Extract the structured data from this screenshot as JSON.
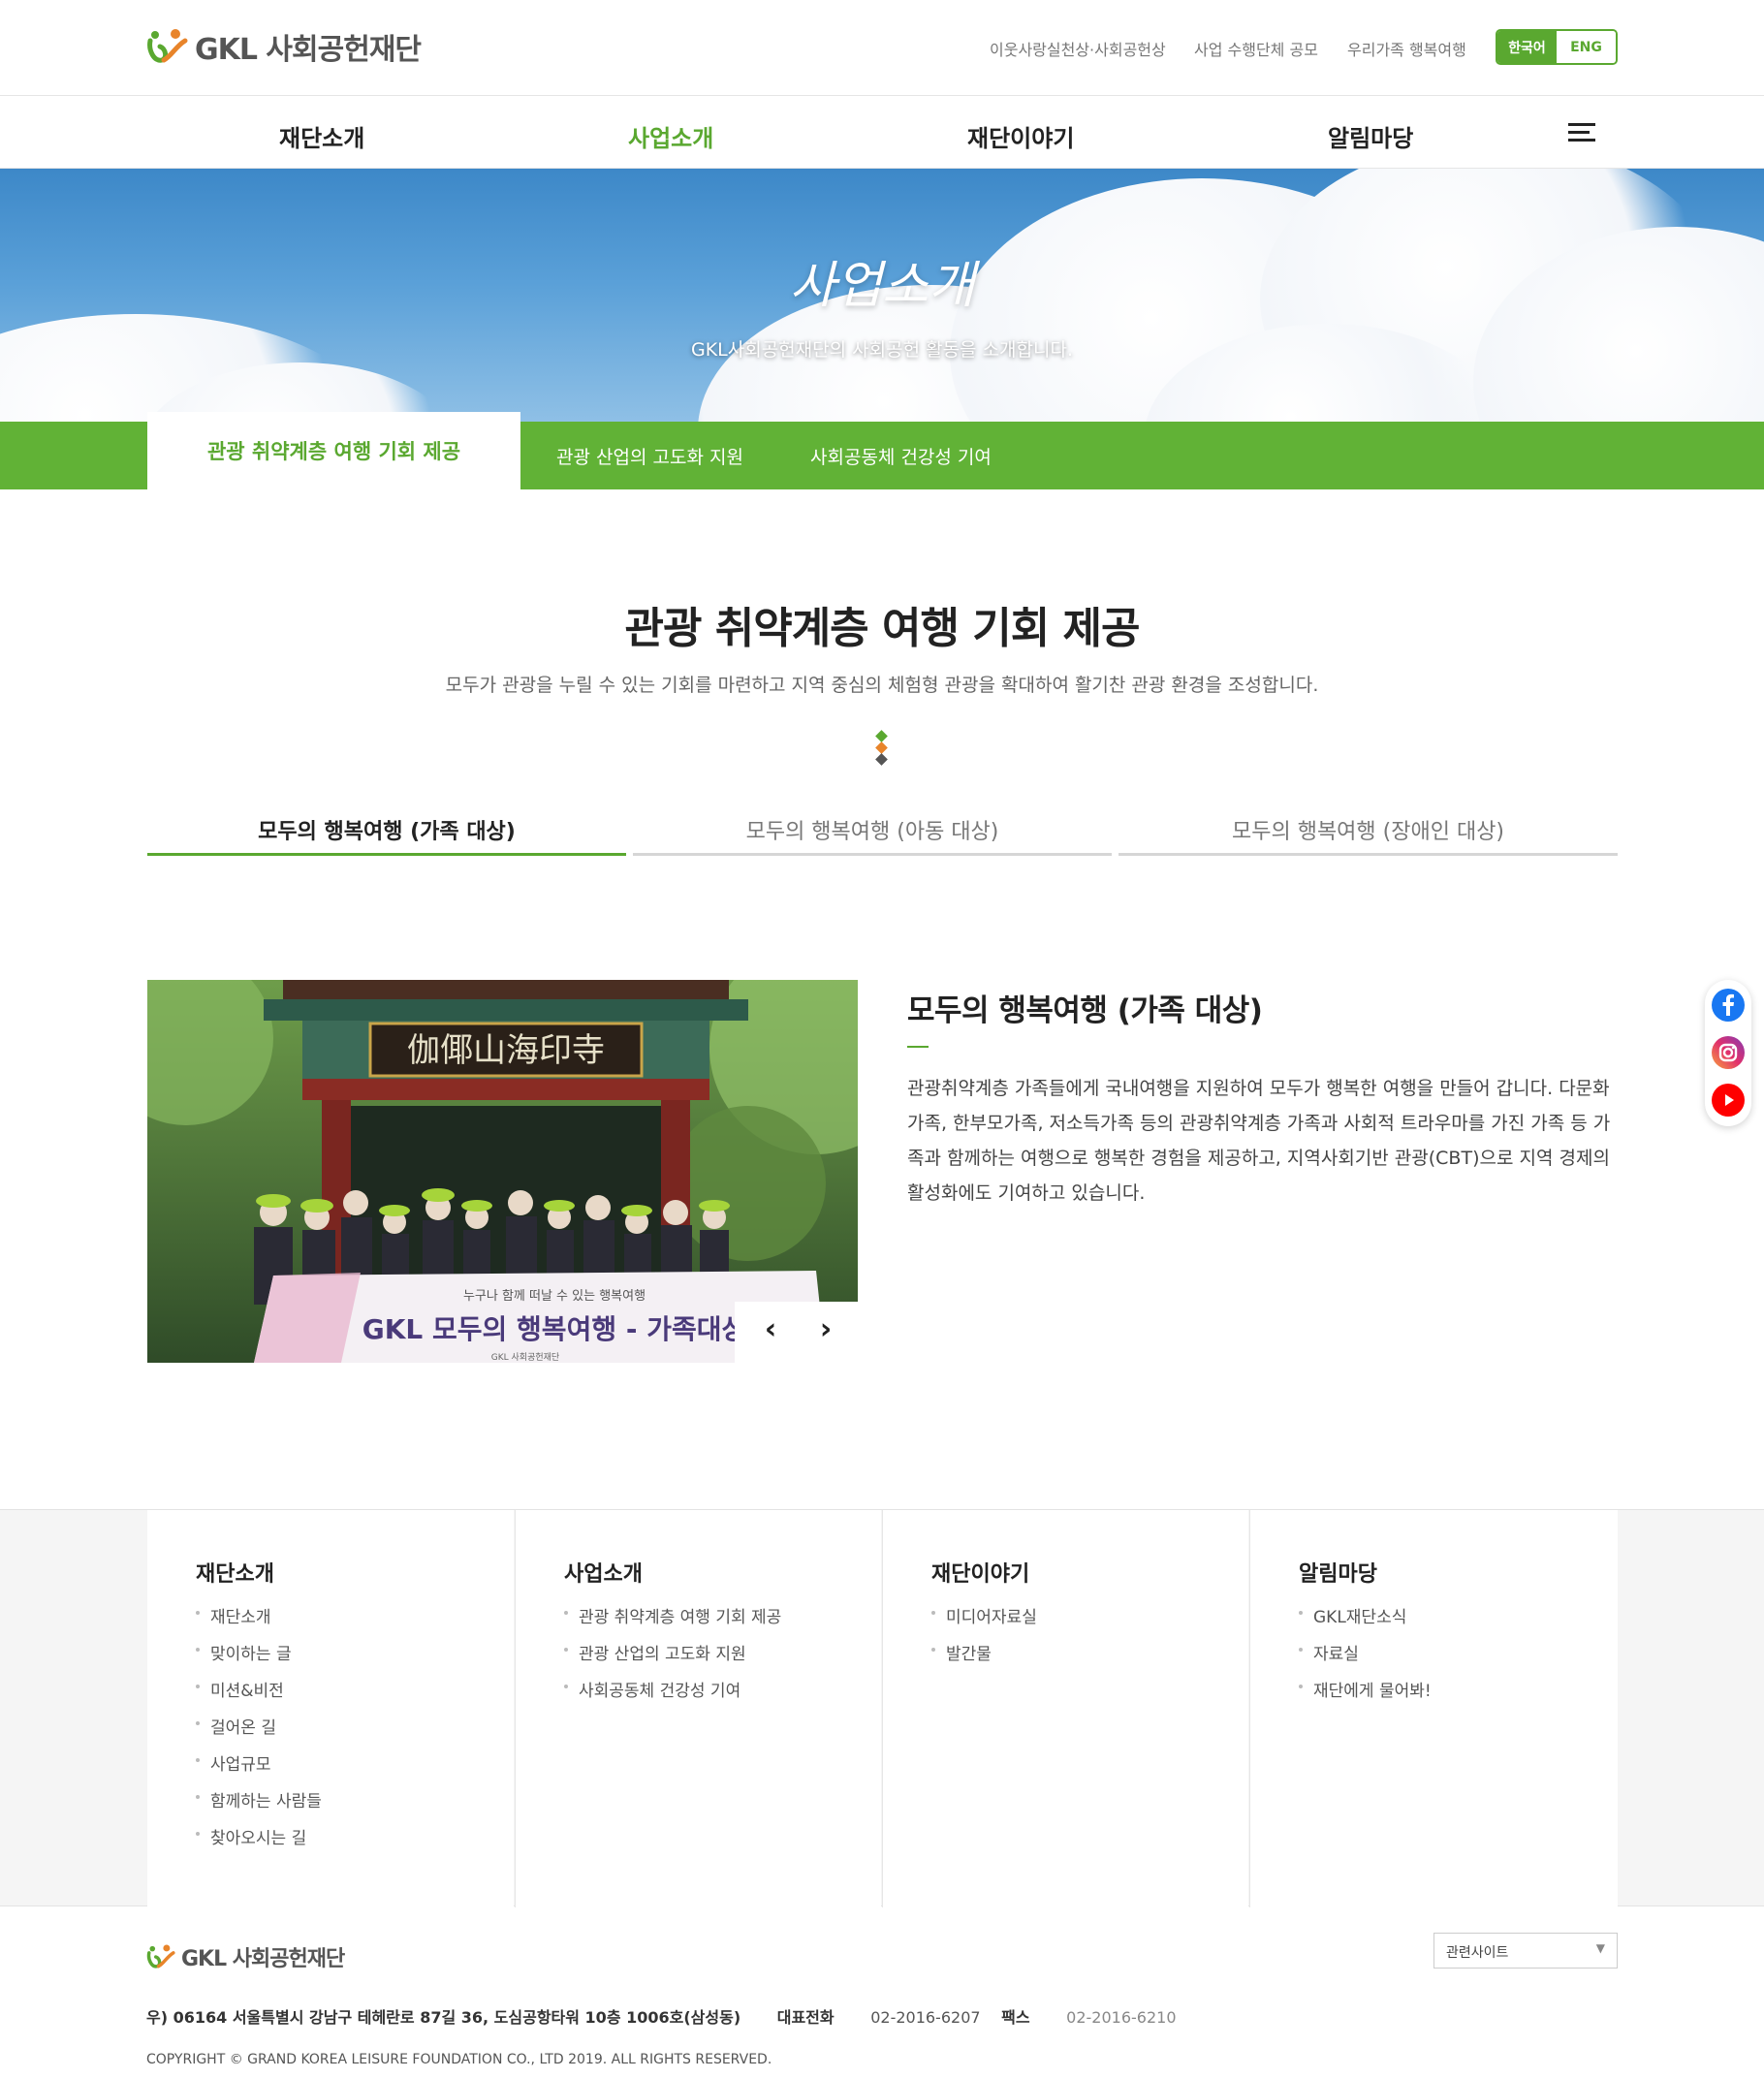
{
  "header": {
    "logo_text": "GKL 사회공헌재단",
    "util_links": [
      "이웃사랑실천상·사회공헌상",
      "사업 수행단체 공모",
      "우리가족 행복여행"
    ],
    "lang_ko": "한국어",
    "lang_en": "ENG"
  },
  "gnb": {
    "items": [
      "재단소개",
      "사업소개",
      "재단이야기",
      "알림마당"
    ],
    "active": "사업소개"
  },
  "hero": {
    "title": "사업소개",
    "subtitle": "GKL사회공헌재단의 사회공헌 활동을 소개합니다."
  },
  "subtabs": {
    "items": [
      "관광 취약계층 여행 기회 제공",
      "관광 산업의 고도화 지원",
      "사회공동체 건강성 기여"
    ]
  },
  "section": {
    "title": "관광 취약계층 여행 기회 제공",
    "description": "모두가 관광을 누릴 수 있는 기회를 마련하고 지역 중심의 체험형 관광을 확대하여 활기찬 관광 환경을 조성합니다."
  },
  "program_tabs": [
    "모두의 행복여행 (가족 대상)",
    "모두의 행복여행 (아동 대상)",
    "모두의 행복여행 (장애인 대상)"
  ],
  "content": {
    "title": "모두의 행복여행 (가족 대상)",
    "paragraph": "관광취약계층 가족들에게 국내여행을 지원하여 모두가 행복한 여행을 만들어 갑니다. 다문화가족, 한부모가족, 저소득가족 등의 관광취약계층 가족과 사회적 트라우마를 가진 가족 등 가족과 함께하는 여행으로 행복한 경험을 제공하고, 지역사회기반 관광(CBT)으로 지역 경제의 활성화에도 기여하고 있습니다.",
    "photo": {
      "signboard": "伽倻山海印寺",
      "banner_small": "누구나 함께 떠날 수 있는 행복여행",
      "banner_main": "GKL 모두의 행복여행 - 가족대상",
      "banner_logo": "GKL 사회공헌재단"
    },
    "prev_icon": "chevron-left-icon",
    "next_icon": "chevron-right-icon"
  },
  "social": [
    "facebook-icon",
    "instagram-icon",
    "youtube-icon"
  ],
  "sitemap": [
    {
      "head": "재단소개",
      "items": [
        "재단소개",
        "맞이하는 글",
        "미션&비전",
        "걸어온 길",
        "사업규모",
        "함께하는 사람들",
        "찾아오시는 길"
      ]
    },
    {
      "head": "사업소개",
      "items": [
        "관광 취약계층 여행 기회 제공",
        "관광 산업의 고도화 지원",
        "사회공동체 건강성 기여"
      ]
    },
    {
      "head": "재단이야기",
      "items": [
        "미디어자료실",
        "발간물"
      ]
    },
    {
      "head": "알림마당",
      "items": [
        "GKL재단소식",
        "자료실",
        "재단에게 물어봐!"
      ]
    }
  ],
  "footer": {
    "logo_text": "GKL 사회공헌재단",
    "related_site": "관련사이트",
    "address": "우) 06164 서울특별시 강남구 테헤란로 87길 36, 도심공항타워 10층 1006호(삼성동)",
    "phone_label": "대표전화",
    "phone": "02-2016-6207",
    "fax_label": "팩스",
    "fax": "02-2016-6210",
    "copyright": "COPYRIGHT © GRAND KOREA LEISURE FOUNDATION CO., LTD 2019. ALL RIGHTS RESERVED."
  },
  "colors": {
    "brand_green": "#5aa830",
    "subtab_green": "#61b236",
    "accent_orange": "#e8842a"
  }
}
